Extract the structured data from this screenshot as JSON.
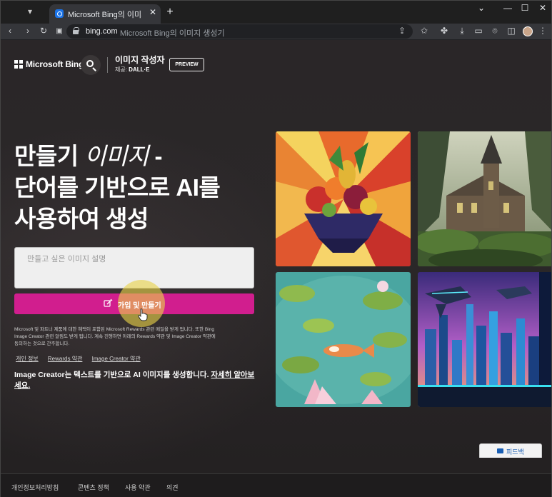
{
  "browser": {
    "tab_title": "Microsoft Bing의 이미지 생성기",
    "url_host": "bing.com",
    "url_path": "Microsoft Bing의 이미지 생성기"
  },
  "header": {
    "brand": "Microsoft Bing",
    "product_title": "이미지 작성자",
    "product_sub_prefix": "제공: ",
    "product_sub_brand": "DALL·E",
    "preview_label": "PREVIEW"
  },
  "hero": {
    "line1_a": "만들기 ",
    "line1_em": "이미지",
    "line1_b": " -",
    "line2": "단어를 기반으로 AI를",
    "line3": "사용하여 생성"
  },
  "prompt": {
    "placeholder": "만들고 싶은 이미지 설명"
  },
  "create_button": {
    "label": "가입 및 만들기"
  },
  "legal_text": "Microsoft 및 파트너 제품에 대한 혜택이 포함된 Microsoft Rewards 관련 메일을 받게 됩니다. 또한 Bing Image Creator 관련 알림도 받게 됩니다. 계속 진행하면 아래의 Rewards 약관 및 Image Creator 약관에 동의하는 것으로 간주합니다.",
  "links": [
    "개인 정보",
    "Rewards 약관",
    "Image Creator 약관"
  ],
  "about": {
    "text": "Image Creator는 텍스트를 기반으로 AI 이미지를 생성합니다. ",
    "link": "자세히 알아보세요."
  },
  "footer": {
    "links": [
      "개인정보처리방침",
      "콘텐츠 정책",
      "사용 약관",
      "의견"
    ],
    "feedback": "피드백"
  },
  "colors": {
    "accent": "#d11e8e",
    "background": "#2a2628"
  },
  "icons": [
    "search-icon",
    "lock-icon",
    "create-icon",
    "feedback-icon"
  ]
}
